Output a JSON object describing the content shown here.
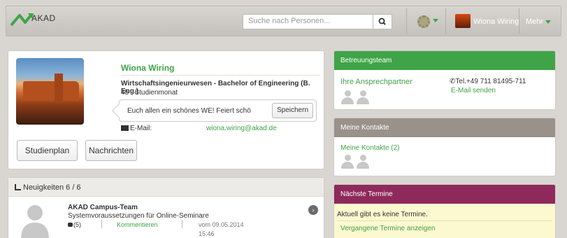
{
  "colors": {
    "accent": "#3fa447",
    "team_header": "#3fa447",
    "contacts_header": "#9b918b",
    "events_header": "#8e2a5b",
    "events_bg": "#fcf8d0"
  },
  "header": {
    "logo_text": "AKAD",
    "search_placeholder": "Suche nach Personen...",
    "search_icon": "search-icon",
    "settings_icon": "gear-icon",
    "user_name": "Wiona Wiring",
    "more_label": "Mehr"
  },
  "profile": {
    "name": "Wiona Wiring",
    "program": "Wirtschaftsingenieurwesen - Bachelor of Engineering (B. Eng.)",
    "semester": "45 . Studienmonat",
    "status_text": "Euch allen ein schönes WE! Feiert schö",
    "save_label": "Speichern",
    "email_label": "E-Mail:",
    "email": "wiona.wiring@akad.de",
    "btn_plan": "Studienplan",
    "btn_messages": "Nachrichten"
  },
  "news": {
    "header": "Neuigkeiten 6 / 6",
    "items": [
      {
        "author": "AKAD Campus-Team",
        "title": "Systemvoraussetzungen für Online-Seminare",
        "comment_count": "(5)",
        "comment_action": "Kommentieren",
        "date": "vom 09.05.2014",
        "time": "15:46"
      }
    ]
  },
  "team": {
    "header": "Betreuungsteam",
    "contacts_label": "Ihre Ansprechpartner",
    "phone": "Tel.+49 711 81495-711",
    "mail_link": "E-Mail senden"
  },
  "contacts": {
    "header": "Meine Kontakte",
    "link": "Meine Kontakte (2)"
  },
  "events": {
    "header": "Nächste Termine",
    "empty_text": "Aktuell gibt es keine Termine.",
    "past_link": "Vergangene Termine anzeigen"
  }
}
